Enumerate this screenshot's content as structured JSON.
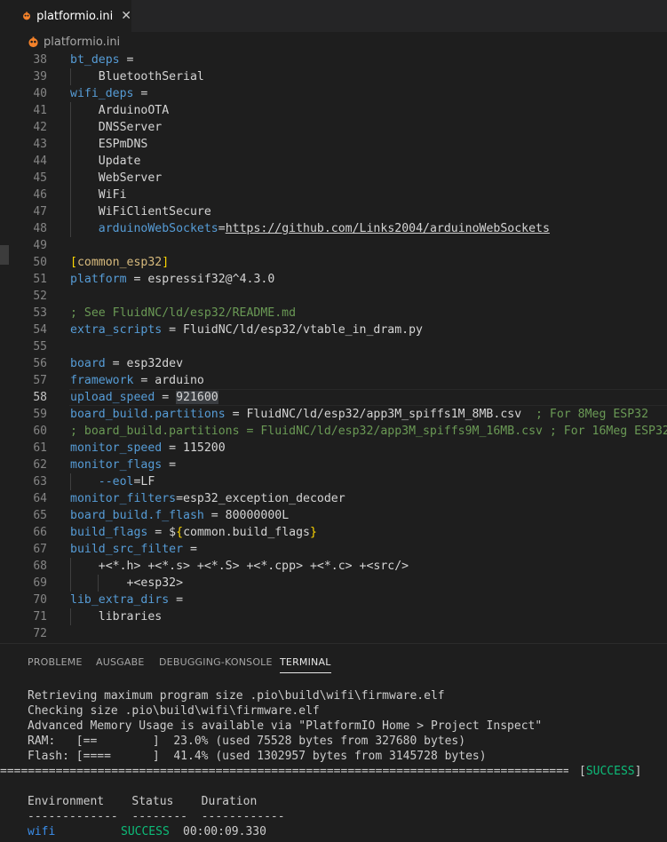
{
  "tab": {
    "label": "platformio.ini",
    "close": "✕"
  },
  "breadcrumb": {
    "label": "platformio.ini"
  },
  "editor": {
    "active_line": "58",
    "lines": [
      {
        "n": "38",
        "t": "bt_deps = "
      },
      {
        "n": "39",
        "t": "    BluetoothSerial"
      },
      {
        "n": "40",
        "t": "wifi_deps = "
      },
      {
        "n": "41",
        "t": "    ArduinoOTA"
      },
      {
        "n": "42",
        "t": "    DNSServer"
      },
      {
        "n": "43",
        "t": "    ESPmDNS"
      },
      {
        "n": "44",
        "t": "    Update"
      },
      {
        "n": "45",
        "t": "    WebServer"
      },
      {
        "n": "46",
        "t": "    WiFi"
      },
      {
        "n": "47",
        "t": "    WiFiClientSecure"
      },
      {
        "n": "48",
        "t": "    arduinoWebSockets=https://github.com/Links2004/arduinoWebSockets"
      },
      {
        "n": "49",
        "t": ""
      },
      {
        "n": "50",
        "t": "[common_esp32]"
      },
      {
        "n": "51",
        "t": "platform = espressif32@^4.3.0"
      },
      {
        "n": "52",
        "t": ""
      },
      {
        "n": "53",
        "t": "; See FluidNC/ld/esp32/README.md"
      },
      {
        "n": "54",
        "t": "extra_scripts = FluidNC/ld/esp32/vtable_in_dram.py"
      },
      {
        "n": "55",
        "t": ""
      },
      {
        "n": "56",
        "t": "board = esp32dev"
      },
      {
        "n": "57",
        "t": "framework = arduino"
      },
      {
        "n": "58",
        "t": "upload_speed = 921600"
      },
      {
        "n": "59",
        "t": "board_build.partitions = FluidNC/ld/esp32/app3M_spiffs1M_8MB.csv  ; For 8Meg ESP32"
      },
      {
        "n": "60",
        "t": "; board_build.partitions = FluidNC/ld/esp32/app3M_spiffs9M_16MB.csv ; For 16Meg ESP32"
      },
      {
        "n": "61",
        "t": "monitor_speed = 115200"
      },
      {
        "n": "62",
        "t": "monitor_flags = "
      },
      {
        "n": "63",
        "t": "    --eol=LF"
      },
      {
        "n": "64",
        "t": "monitor_filters=esp32_exception_decoder"
      },
      {
        "n": "65",
        "t": "board_build.f_flash = 80000000L"
      },
      {
        "n": "66",
        "t": "build_flags = ${common.build_flags}"
      },
      {
        "n": "67",
        "t": "build_src_filter = "
      },
      {
        "n": "68",
        "t": "    +<*.h> +<*.s> +<*.S> +<*.cpp> +<*.c> +<src/>"
      },
      {
        "n": "69",
        "t": "        +<esp32>"
      },
      {
        "n": "70",
        "t": "lib_extra_dirs = "
      },
      {
        "n": "71",
        "t": "    libraries"
      },
      {
        "n": "72",
        "t": ""
      }
    ]
  },
  "panel": {
    "tabs": [
      "PROBLEME",
      "AUSGABE",
      "DEBUGGING-KONSOLE",
      "TERMINAL"
    ],
    "active_tab": "TERMINAL"
  },
  "terminal": {
    "lines": [
      "Retrieving maximum program size .pio\\build\\wifi\\firmware.elf",
      "Checking size .pio\\build\\wifi\\firmware.elf",
      "Advanced Memory Usage is available via \"PlatformIO Home > Project Inspect\"",
      "RAM:   [==        ]  23.0% (used 75528 bytes from 327680 bytes)",
      "Flash: [====      ]  41.4% (used 1302957 bytes from 3145728 bytes)"
    ],
    "separator": "==========================================================================================",
    "success_tag": "[SUCCESS]",
    "table_header": "Environment    Status    Duration",
    "table_rule": "-------------  --------  ------------",
    "row_env": "wifi",
    "row_status": "SUCCESS",
    "row_duration": "00:00:09.330"
  },
  "colors": {
    "keyword": "#569cd6",
    "comment": "#6a9955",
    "success": "#0dbc79",
    "env": "#3b8eea"
  }
}
